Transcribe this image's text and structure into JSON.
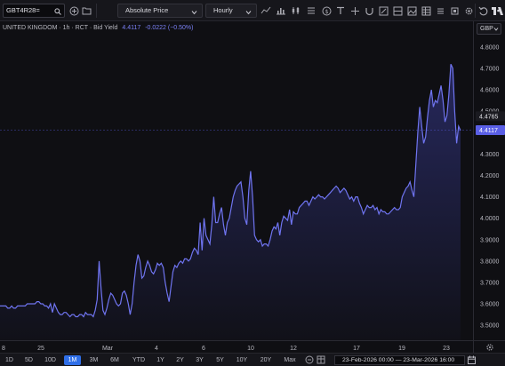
{
  "toolbar": {
    "symbol": "GBT4R28=",
    "price_type": "Absolute Price",
    "interval": "Hourly",
    "icons": [
      "search-icon",
      "add-compare-icon",
      "folder-icon",
      "chevron-down-icon",
      "bar-chart-icon",
      "candles-icon",
      "line-chart-icon",
      "currency-icon",
      "text-icon",
      "crosshair-icon",
      "measure-icon",
      "image-icon",
      "table-icon",
      "settings-icon",
      "undo-icon",
      "tradingview-logo-icon"
    ]
  },
  "legend": {
    "name": "UNITED KINGDOM · 1h · RCT · Bid Yield",
    "value": "4.4117",
    "change": "-0.0222 (−0.50%)"
  },
  "price_axis": {
    "currency": "GBP",
    "last_price_label": "4.4117",
    "prev_price_label": "4.4765",
    "ticks": [
      "4.8000",
      "4.7000",
      "4.6000",
      "4.5000",
      "4.3000",
      "4.2000",
      "4.1000",
      "4.0000",
      "3.9000",
      "3.8000",
      "3.7000",
      "3.6000",
      "3.5000"
    ]
  },
  "time_axis": {
    "ticks": [
      "8",
      "25",
      "Mar",
      "4",
      "6",
      "10",
      "12",
      "17",
      "19",
      "23"
    ]
  },
  "bottom": {
    "ranges": [
      "1D",
      "5D",
      "10D",
      "1M",
      "3M",
      "6M",
      "YTD",
      "1Y",
      "2Y",
      "3Y",
      "5Y",
      "10Y",
      "20Y",
      "Max"
    ],
    "active_range": "1M",
    "date_range": "23-Feb-2026 00:00 — 23-Mar-2026 16:00"
  },
  "colors": {
    "line": "#6f74f0",
    "fill_top": "#3a3d9a",
    "last_price_bg": "#5a5fe6",
    "active_range": "#2f6fe8"
  },
  "chart_data": {
    "type": "area",
    "title": "UNITED KINGDOM · 1h · RCT · Bid Yield",
    "xlabel": "",
    "ylabel": "",
    "ylim": [
      3.43,
      4.92
    ],
    "x_ticks": [
      "8",
      "25",
      "Mar",
      "4",
      "6",
      "10",
      "12",
      "17",
      "19",
      "23"
    ],
    "grid": false,
    "series": [
      {
        "values": [
          3.59,
          3.59,
          3.59,
          3.59,
          3.58,
          3.58,
          3.59,
          3.58,
          3.58,
          3.59,
          3.59,
          3.59,
          3.59,
          3.59,
          3.6,
          3.6,
          3.6,
          3.6,
          3.6,
          3.61,
          3.61,
          3.6,
          3.6,
          3.59,
          3.59,
          3.58,
          3.6,
          3.56,
          3.6,
          3.58,
          3.56,
          3.55,
          3.55,
          3.56,
          3.56,
          3.55,
          3.54,
          3.55,
          3.55,
          3.54,
          3.54,
          3.55,
          3.55,
          3.54,
          3.56,
          3.55,
          3.55,
          3.55,
          3.54,
          3.57,
          3.62,
          3.8,
          3.67,
          3.57,
          3.55,
          3.58,
          3.62,
          3.65,
          3.64,
          3.62,
          3.6,
          3.59,
          3.6,
          3.65,
          3.66,
          3.64,
          3.6,
          3.55,
          3.6,
          3.7,
          3.78,
          3.83,
          3.8,
          3.72,
          3.73,
          3.77,
          3.8,
          3.78,
          3.75,
          3.74,
          3.76,
          3.79,
          3.78,
          3.79,
          3.77,
          3.7,
          3.65,
          3.61,
          3.68,
          3.75,
          3.78,
          3.77,
          3.79,
          3.8,
          3.79,
          3.81,
          3.81,
          3.8,
          3.81,
          3.84,
          3.86,
          3.85,
          3.83,
          3.98,
          3.85,
          4.0,
          3.92,
          3.9,
          3.88,
          3.97,
          4.1,
          3.98,
          3.98,
          4.02,
          4.05,
          3.97,
          3.92,
          3.98,
          4.0,
          4.05,
          4.1,
          4.13,
          4.15,
          4.16,
          4.17,
          4.1,
          4.0,
          3.97,
          4.13,
          4.22,
          4.1,
          3.92,
          3.9,
          3.89,
          3.9,
          3.87,
          3.88,
          3.88,
          3.87,
          3.9,
          3.94,
          3.96,
          3.95,
          3.98,
          3.92,
          3.98,
          4.01,
          4.0,
          3.99,
          4.04,
          3.97,
          4.03,
          4.02,
          4.02,
          4.05,
          4.06,
          4.07,
          4.08,
          4.08,
          4.06,
          4.08,
          4.1,
          4.09,
          4.1,
          4.11,
          4.1,
          4.1,
          4.09,
          4.1,
          4.11,
          4.12,
          4.13,
          4.14,
          4.15,
          4.14,
          4.12,
          4.13,
          4.14,
          4.13,
          4.11,
          4.09,
          4.1,
          4.08,
          4.1,
          4.1,
          4.07,
          4.05,
          4.02,
          4.04,
          4.06,
          4.05,
          4.05,
          4.06,
          4.04,
          4.05,
          4.02,
          4.04,
          4.03,
          4.03,
          4.02,
          4.02,
          4.03,
          4.04,
          4.05,
          4.04,
          4.04,
          4.05,
          4.1,
          4.12,
          4.14,
          4.15,
          4.17,
          4.13,
          4.1,
          4.25,
          4.4,
          4.52,
          4.43,
          4.35,
          4.38,
          4.47,
          4.55,
          4.6,
          4.52,
          4.55,
          4.54,
          4.58,
          4.62,
          4.55,
          4.45,
          4.48,
          4.58,
          4.72,
          4.7,
          4.5,
          4.35,
          4.43,
          4.41
        ]
      }
    ]
  }
}
